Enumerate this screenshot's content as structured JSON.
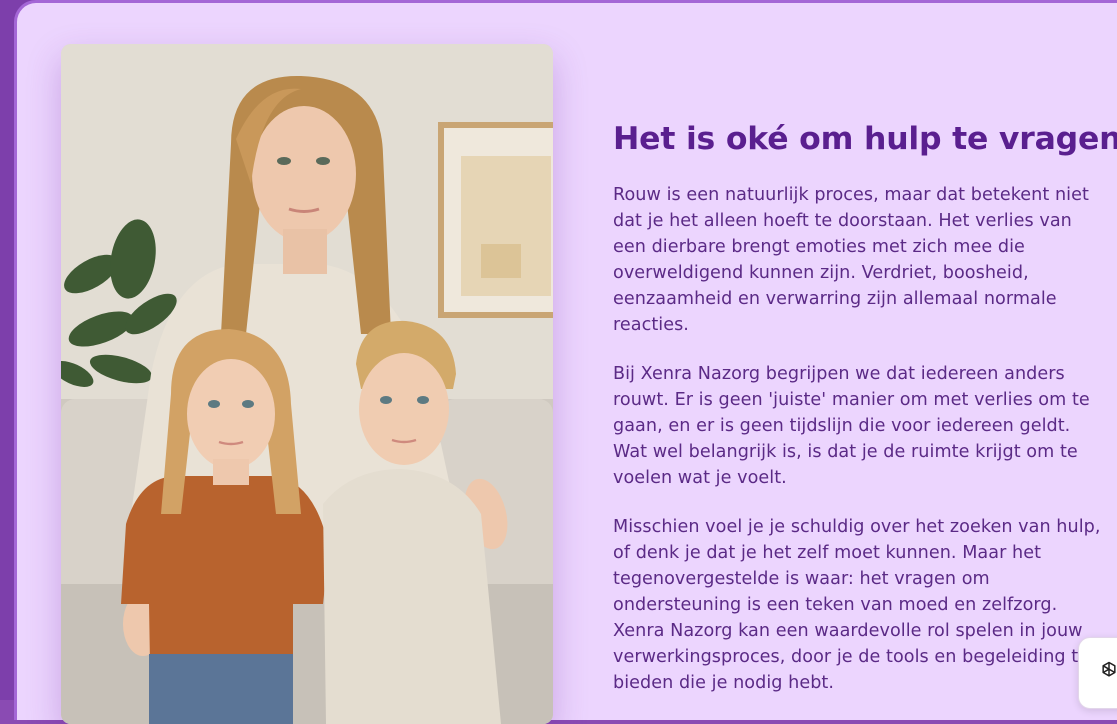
{
  "section": {
    "title": "Het is oké om hulp te vragen",
    "paragraphs": [
      "Rouw is een natuurlijk proces, maar dat betekent niet dat je het alleen hoeft te doorstaan. Het verlies van een dierbare brengt emoties met zich mee die overweldigend kunnen zijn. Verdriet, boosheid, eenzaamheid en verwarring zijn allemaal normale reacties.",
      "Bij Xenra Nazorg begrijpen we dat iedereen anders rouwt. Er is geen 'juiste' manier om met verlies om te gaan, en er is geen tijdslijn die voor iedereen geldt. Wat wel belangrijk is, is dat je de ruimte krijgt om te voelen wat je voelt.",
      "Misschien voel je je schuldig over het zoeken van hulp, of denk je dat je het zelf moet kunnen. Maar het tegenovergestelde is waar: het vragen om ondersteuning is een teken van moed en zelfzorg. Xenra Nazorg kan een waardevolle rol spelen in jouw verwerkingsproces, door je de tools en begeleiding te bieden die je nodig hebt."
    ]
  },
  "assistant": {
    "icon": "assistant-icon"
  },
  "colors": {
    "frame": "#7d3fab",
    "card_background": "#ecd5fe",
    "title": "#5a1f8f",
    "body_text": "#5b2a86"
  }
}
